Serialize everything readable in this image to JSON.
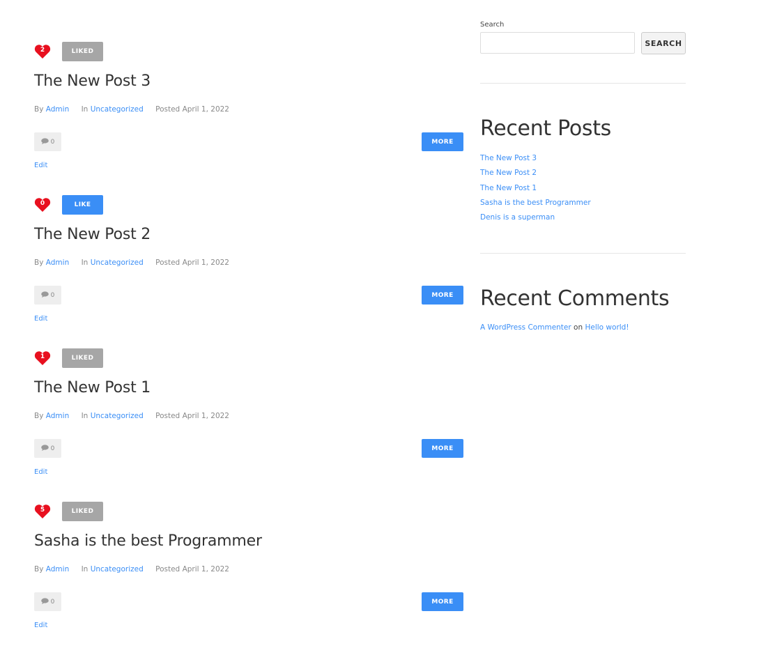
{
  "colors": {
    "accent": "#3a8ef6",
    "liked_gray": "#a6a6a6",
    "heart_red": "#e8101f"
  },
  "posts": [
    {
      "like_count": "2",
      "like_label": "LIKED",
      "liked": true,
      "title": "The New Post 3",
      "by_label": "By",
      "author": "Admin",
      "in_label": "In",
      "category": "Uncategorized",
      "posted_label": "Posted",
      "date": "April 1, 2022",
      "comment_count": "0",
      "more_label": "MORE",
      "edit_label": "Edit"
    },
    {
      "like_count": "0",
      "like_label": "LIKE",
      "liked": false,
      "title": "The New Post 2",
      "by_label": "By",
      "author": "Admin",
      "in_label": "In",
      "category": "Uncategorized",
      "posted_label": "Posted",
      "date": "April 1, 2022",
      "comment_count": "0",
      "more_label": "MORE",
      "edit_label": "Edit"
    },
    {
      "like_count": "1",
      "like_label": "LIKED",
      "liked": true,
      "title": "The New Post 1",
      "by_label": "By",
      "author": "Admin",
      "in_label": "In",
      "category": "Uncategorized",
      "posted_label": "Posted",
      "date": "April 1, 2022",
      "comment_count": "0",
      "more_label": "MORE",
      "edit_label": "Edit"
    },
    {
      "like_count": "5",
      "like_label": "LIKED",
      "liked": true,
      "title": "Sasha is the best Programmer",
      "by_label": "By",
      "author": "Admin",
      "in_label": "In",
      "category": "Uncategorized",
      "posted_label": "Posted",
      "date": "April 1, 2022",
      "comment_count": "0",
      "more_label": "MORE",
      "edit_label": "Edit"
    }
  ],
  "sidebar": {
    "search": {
      "label": "Search",
      "placeholder": "",
      "button_label": "SEARCH"
    },
    "recent_posts": {
      "title": "Recent Posts",
      "items": [
        "The New Post 3",
        "The New Post 2",
        "The New Post 1",
        "Sasha is the best Programmer",
        "Denis is a superman"
      ]
    },
    "recent_comments": {
      "title": "Recent Comments",
      "author": "A WordPress Commenter",
      "on_label": "on",
      "post": "Hello world!"
    }
  }
}
